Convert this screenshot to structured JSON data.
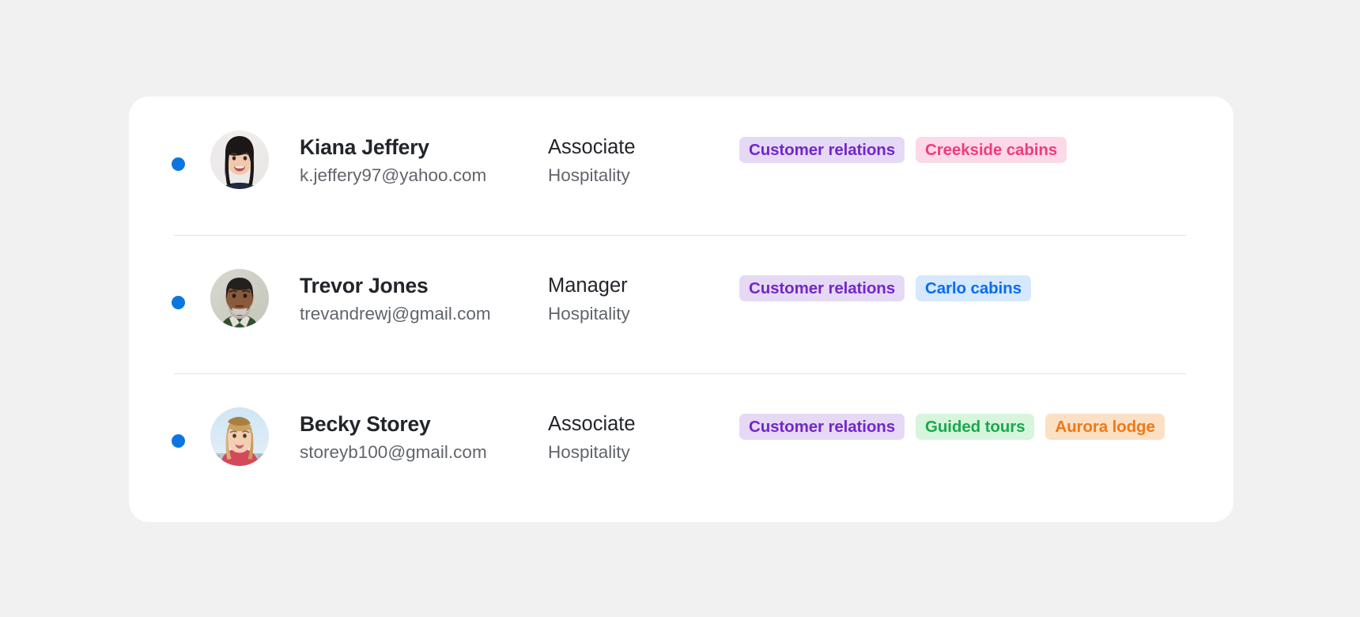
{
  "page": {
    "background_color": "#f1f1f1",
    "card_background_color": "#ffffff"
  },
  "list": {
    "status_dot_color": "#0b76e0",
    "divider_color": "#e3e4e6",
    "rows": [
      {
        "status": "active",
        "avatar": "woman-dark-hair-avatar",
        "name": "Kiana Jeffery",
        "email": "k.jeffery97@yahoo.com",
        "role": "Associate",
        "department": "Hospitality",
        "tags": [
          {
            "label": "Customer relations",
            "text_color": "#7327c9",
            "bg_color": "#e6d9f5"
          },
          {
            "label": "Creekside cabins",
            "text_color": "#f03b7e",
            "bg_color": "#fcd9e8"
          }
        ]
      },
      {
        "status": "active",
        "avatar": "older-man-beard-avatar",
        "name": "Trevor Jones",
        "email": "trevandrewj@gmail.com",
        "role": "Manager",
        "department": "Hospitality",
        "tags": [
          {
            "label": "Customer relations",
            "text_color": "#7327c9",
            "bg_color": "#e6d9f5"
          },
          {
            "label": "Carlo cabins",
            "text_color": "#0b6bf0",
            "bg_color": "#d5e8fd"
          }
        ]
      },
      {
        "status": "active",
        "avatar": "blonde-woman-avatar",
        "name": "Becky Storey",
        "email": "storeyb100@gmail.com",
        "role": "Associate",
        "department": "Hospitality",
        "tags": [
          {
            "label": "Customer relations",
            "text_color": "#7327c9",
            "bg_color": "#e6d9f5"
          },
          {
            "label": "Guided tours",
            "text_color": "#18aa4b",
            "bg_color": "#d6f5dc"
          },
          {
            "label": "Aurora lodge",
            "text_color": "#f07816",
            "bg_color": "#fce0c3"
          }
        ]
      }
    ]
  }
}
